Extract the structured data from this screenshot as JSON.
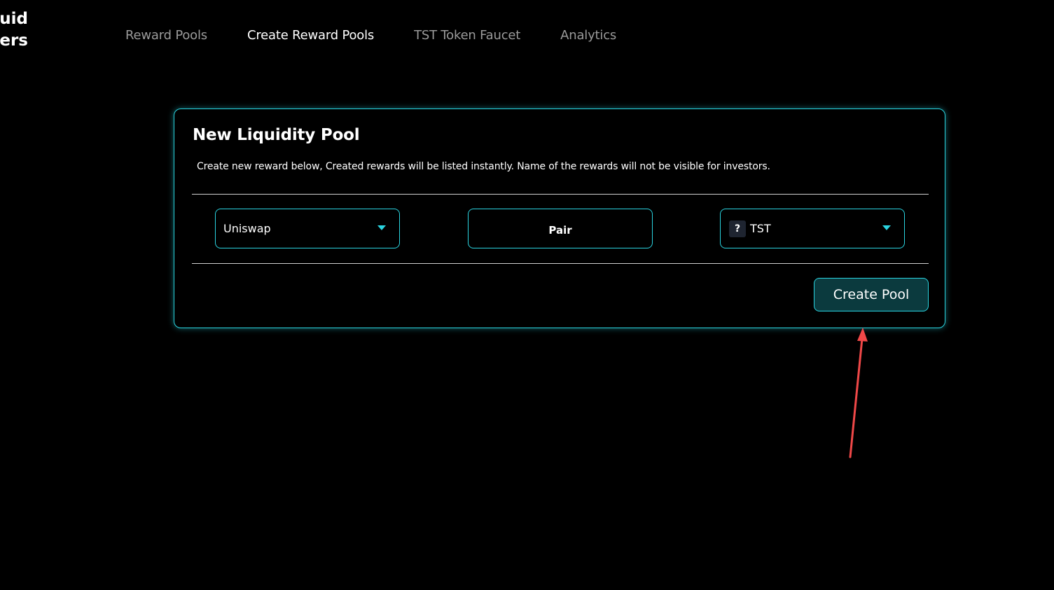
{
  "brand": {
    "line1": "uid",
    "line2": "ers"
  },
  "nav": {
    "items": [
      {
        "label": "Reward Pools",
        "active": false
      },
      {
        "label": "Create Reward Pools",
        "active": true
      },
      {
        "label": "TST Token Faucet",
        "active": false
      },
      {
        "label": "Analytics",
        "active": false
      }
    ]
  },
  "card": {
    "title": "New Liquidity Pool",
    "description": "Create new reward below, Created rewards will be listed instantly. Name of the rewards will not be visible for investors.",
    "dex_select": {
      "value": "Uniswap"
    },
    "pair_field": {
      "label": "Pair"
    },
    "token_select": {
      "icon_glyph": "?",
      "value": "TST"
    },
    "create_button": {
      "label": "Create Pool"
    }
  },
  "colors": {
    "accent": "#2ad4e0",
    "button_bg": "#0b3a3e",
    "annotation_arrow": "#f04848",
    "background": "#000000",
    "nav_inactive": "#9a9a9a"
  },
  "icons": {
    "dropdown": "chevron-down-icon",
    "token": "unknown-token-icon",
    "annotation": "red-arrow-annotation"
  }
}
